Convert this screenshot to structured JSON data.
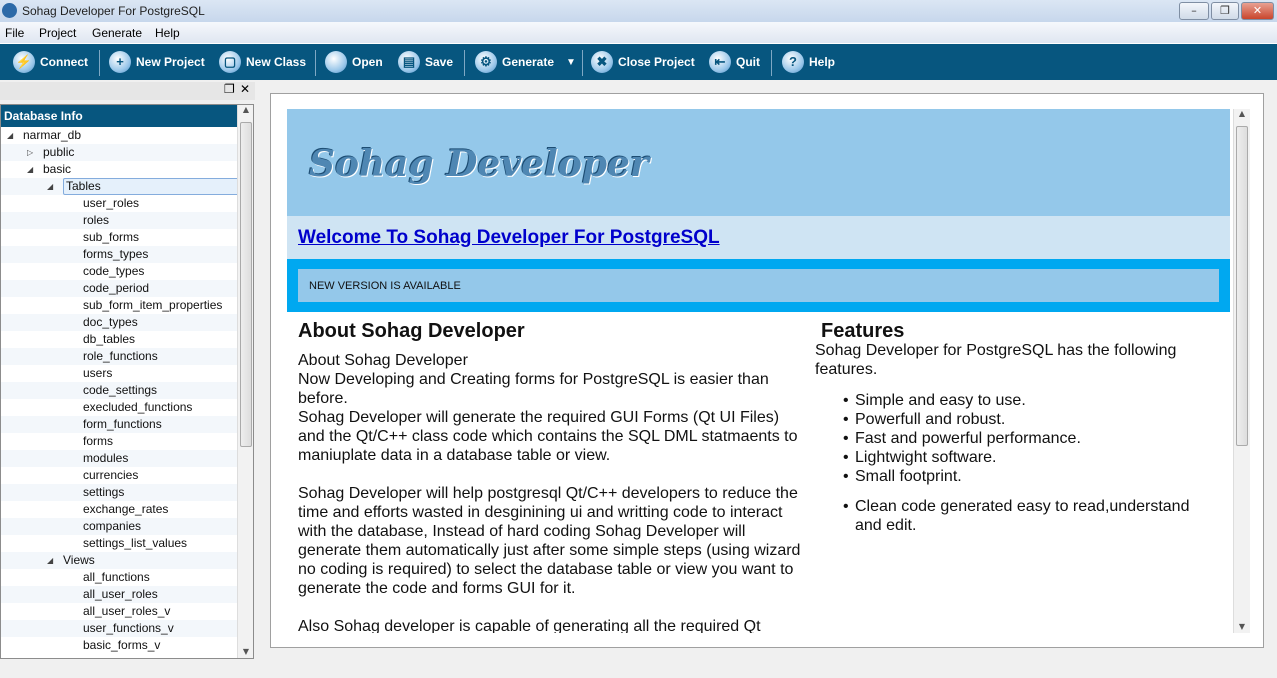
{
  "window": {
    "title": "Sohag Developer For PostgreSQL",
    "controls": [
      "minimize",
      "restore",
      "close"
    ]
  },
  "menu": [
    "File",
    "Project",
    "Generate",
    "Help"
  ],
  "toolbar": {
    "connect": "Connect",
    "new_project": "New Project",
    "new_class": "New Class",
    "open": "Open",
    "save": "Save",
    "generate": "Generate",
    "close_project": "Close Project",
    "quit": "Quit",
    "help": "Help"
  },
  "dock": {
    "title": "Database Info",
    "db": "narmar_db",
    "schemas": [
      "public",
      "basic"
    ],
    "tables_label": "Tables",
    "tables": [
      "user_roles",
      "roles",
      "sub_forms",
      "forms_types",
      "code_types",
      "code_period",
      "sub_form_item_properties",
      "doc_types",
      "db_tables",
      "role_functions",
      "users",
      "code_settings",
      "execluded_functions",
      "form_functions",
      "forms",
      "modules",
      "currencies",
      "settings",
      "exchange_rates",
      "companies",
      "settings_list_values"
    ],
    "views_label": "Views",
    "views": [
      "all_functions",
      "all_user_roles",
      "all_user_roles_v",
      "user_functions_v",
      "basic_forms_v"
    ]
  },
  "page": {
    "logo": "Sohag Developer",
    "welcome": "Welcome To Sohag Developer For PostgreSQL",
    "notice": "NEW VERSION IS AVAILABLE",
    "about_title": "About Sohag Developer",
    "about_lines": [
      "About Sohag Developer",
      "Now Developing and Creating forms for PostgreSQL is easier than before.",
      "Sohag Developer will generate the required GUI Forms (Qt UI Files) and the Qt/C++ class code which contains the SQL DML statmaents to maniuplate data in a database table or view."
    ],
    "about_p2": "Sohag Developer will help postgresql Qt/C++ developers to reduce the time and efforts wasted in desginining ui and writting code to interact with the database, Instead of hard coding Sohag Developer will generate them automatically just after some simple steps (using wizard no coding is required) to select the database table or view you want to generate the code and forms GUI for it.",
    "about_p3": "Also Sohag developer is capable of generating all the required Qt",
    "features_title": "Features",
    "features_intro": "Sohag Developer for PostgreSQL has the following features.",
    "features": [
      "Simple and easy to use.",
      "Powerfull and robust.",
      "Fast and powerful performance.",
      "Lightwight software.",
      "Small footprint."
    ],
    "features_extra": "Clean code generated easy to read,understand and edit."
  }
}
